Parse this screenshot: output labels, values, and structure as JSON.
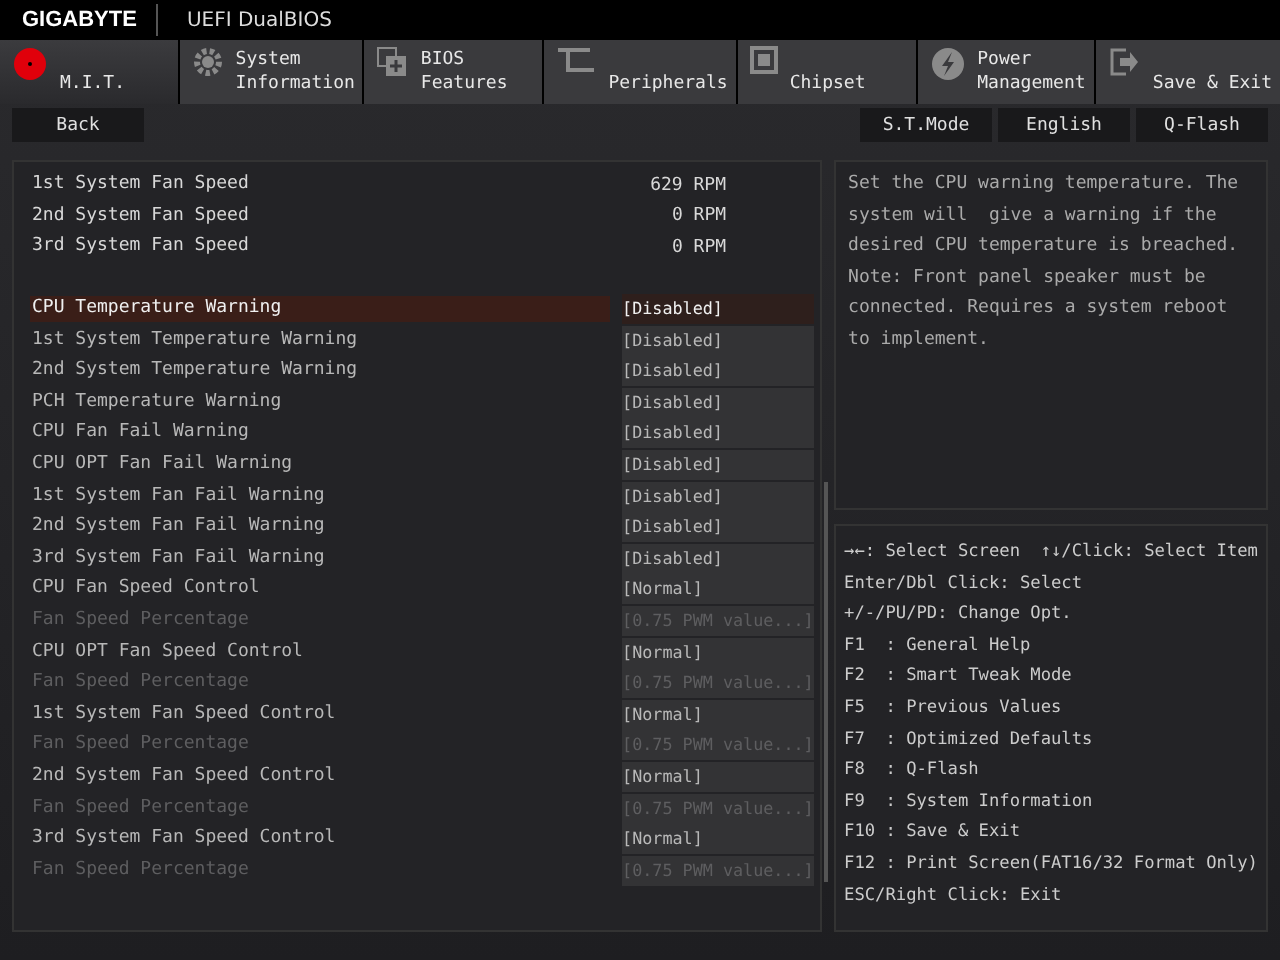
{
  "header": {
    "brand": "GIGABYTE",
    "title": "UEFI DualBIOS"
  },
  "tabs": [
    {
      "kind": "dot",
      "lines": [
        "M.I.T."
      ],
      "selected": true
    },
    {
      "kind": "gear",
      "lines": [
        "System",
        "Information"
      ],
      "selected": false
    },
    {
      "kind": "bios",
      "lines": [
        "BIOS",
        "Features"
      ],
      "selected": false
    },
    {
      "kind": "ports",
      "lines": [
        "Peripherals"
      ],
      "selected": false
    },
    {
      "kind": "chip",
      "lines": [
        "Chipset"
      ],
      "selected": false
    },
    {
      "kind": "power",
      "lines": [
        "Power",
        "Management"
      ],
      "selected": false
    },
    {
      "kind": "exit",
      "lines": [
        "Save & Exit"
      ],
      "selected": false
    }
  ],
  "toolbar": {
    "back": "Back",
    "buttons": [
      "S.T.Mode",
      "English",
      "Q-Flash"
    ]
  },
  "readings": [
    {
      "label": "1st System Fan Speed",
      "value": "629 RPM"
    },
    {
      "label": "2nd System Fan Speed",
      "value": "0 RPM"
    },
    {
      "label": "3rd System Fan Speed",
      "value": "0 RPM"
    }
  ],
  "settings": [
    {
      "label": "CPU Temperature Warning",
      "value": "[Disabled]",
      "selected": true,
      "disabled": false
    },
    {
      "label": "1st System Temperature Warning",
      "value": "[Disabled]",
      "selected": false,
      "disabled": false
    },
    {
      "label": "2nd System Temperature Warning",
      "value": "[Disabled]",
      "selected": false,
      "disabled": false
    },
    {
      "label": "PCH Temperature Warning",
      "value": "[Disabled]",
      "selected": false,
      "disabled": false
    },
    {
      "label": "CPU Fan Fail Warning",
      "value": "[Disabled]",
      "selected": false,
      "disabled": false
    },
    {
      "label": "CPU OPT Fan Fail Warning",
      "value": "[Disabled]",
      "selected": false,
      "disabled": false
    },
    {
      "label": "1st System Fan Fail Warning",
      "value": "[Disabled]",
      "selected": false,
      "disabled": false
    },
    {
      "label": "2nd System Fan Fail Warning",
      "value": "[Disabled]",
      "selected": false,
      "disabled": false
    },
    {
      "label": "3rd System Fan Fail Warning",
      "value": "[Disabled]",
      "selected": false,
      "disabled": false
    },
    {
      "label": "CPU Fan Speed Control",
      "value": "[Normal]",
      "selected": false,
      "disabled": false
    },
    {
      "label": "Fan Speed Percentage",
      "value": "[0.75 PWM value...]",
      "selected": false,
      "disabled": true
    },
    {
      "label": "CPU OPT Fan Speed Control",
      "value": "[Normal]",
      "selected": false,
      "disabled": false
    },
    {
      "label": "Fan Speed Percentage",
      "value": "[0.75 PWM value...]",
      "selected": false,
      "disabled": true
    },
    {
      "label": "1st System Fan Speed Control",
      "value": "[Normal]",
      "selected": false,
      "disabled": false
    },
    {
      "label": "Fan Speed Percentage",
      "value": "[0.75 PWM value...]",
      "selected": false,
      "disabled": true
    },
    {
      "label": "2nd System Fan Speed Control",
      "value": "[Normal]",
      "selected": false,
      "disabled": false
    },
    {
      "label": "Fan Speed Percentage",
      "value": "[0.75 PWM value...]",
      "selected": false,
      "disabled": true
    },
    {
      "label": "3rd System Fan Speed Control",
      "value": "[Normal]",
      "selected": false,
      "disabled": false
    },
    {
      "label": "Fan Speed Percentage",
      "value": "[0.75 PWM value...]",
      "selected": false,
      "disabled": true
    }
  ],
  "help_text": "Set the CPU warning temperature. The system will  give a warning if the desired CPU temperature is breached. Note: Front panel speaker must be connected. Requires a system reboot to implement.",
  "key_help": [
    "→←: Select Screen  ↑↓/Click: Select Item",
    "Enter/Dbl Click: Select",
    "+/-/PU/PD: Change Opt.",
    "F1  : General Help",
    "F2  : Smart Tweak Mode",
    "F5  : Previous Values",
    "F7  : Optimized Defaults",
    "F8  : Q-Flash",
    "F9  : System Information",
    "F10 : Save & Exit",
    "F12 : Print Screen(FAT16/32 Format Only)",
    "ESC/Right Click: Exit"
  ]
}
